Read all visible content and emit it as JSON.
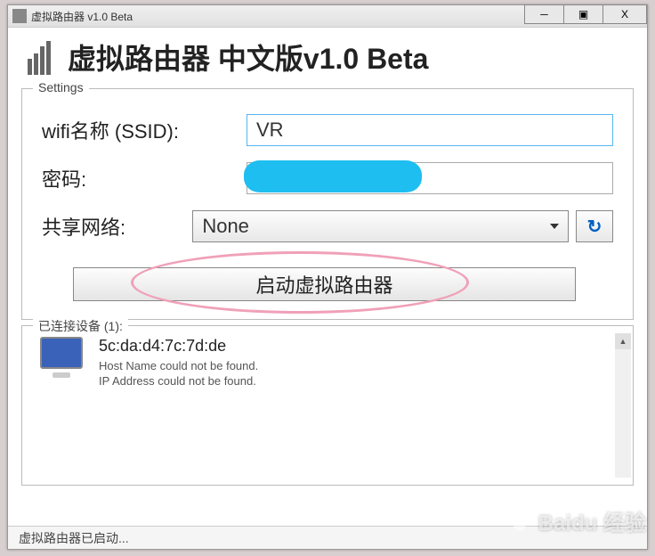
{
  "window": {
    "title": "虚拟路由器 v1.0 Beta"
  },
  "header": {
    "title": "虚拟路由器 中文版v1.0 Beta"
  },
  "settings": {
    "group_label": "Settings",
    "ssid_label": "wifi名称 (SSID):",
    "ssid_value": "VR",
    "password_label": "密码:",
    "network_label": "共享网络:",
    "network_selected": "None",
    "start_button": "启动虚拟路由器"
  },
  "devices": {
    "group_label": "已连接设备 (1):",
    "items": [
      {
        "mac": "5c:da:d4:7c:7d:de",
        "hostname_msg": "Host Name could not be found.",
        "ip_msg": "IP Address could not be found."
      }
    ]
  },
  "statusbar": {
    "text": "虚拟路由器已启动..."
  },
  "watermark": {
    "text": "Baidu 经验"
  }
}
